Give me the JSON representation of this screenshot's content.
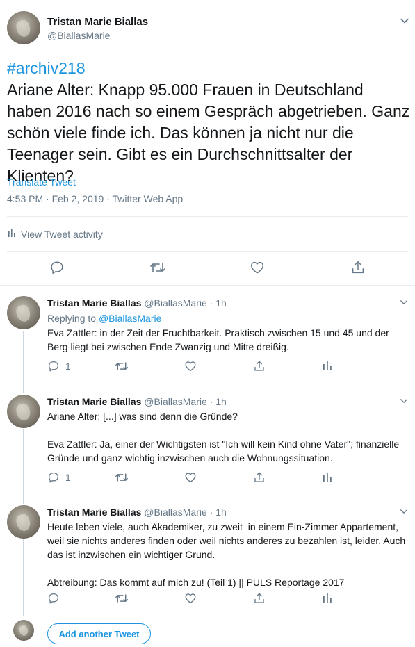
{
  "main_tweet": {
    "author_name": "Tristan Marie Biallas",
    "author_handle": "@BiallasMarie",
    "hashtag": "#archiv218",
    "body": "Ariane Alter: Knapp 95.000 Frauen in Deutschland haben 2016 nach so einem Gespräch abgetrieben. Ganz schön viele finde ich. Das können ja nicht nur die Teenager sein. Gibt es ein Durchschnittsalter der Klienten?",
    "translate_label": "Translate Tweet",
    "meta": "4:53 PM · Feb 2, 2019 · Twitter Web App",
    "activity_label": "View Tweet activity"
  },
  "replies": [
    {
      "author_name": "Tristan Marie Biallas",
      "author_handle": "@BiallasMarie",
      "time": "· 1h",
      "replying_prefix": "Replying to",
      "replying_to": "@BiallasMarie",
      "text": "Eva Zattler: in der Zeit der Fruchtbarkeit. Praktisch zwischen 15 und 45 und der Berg liegt bei zwischen Ende Zwanzig und Mitte dreißig.",
      "reply_count": "1"
    },
    {
      "author_name": "Tristan Marie Biallas",
      "author_handle": "@BiallasMarie",
      "time": "· 1h",
      "text": "Ariane Alter: [...] was sind denn die Gründe?\n\nEva Zattler: Ja, einer der Wichtigsten ist \"Ich will kein Kind ohne Vater\"; finanzielle Gründe und ganz wichtig inzwischen auch die Wohnungssituation.",
      "reply_count": "1"
    },
    {
      "author_name": "Tristan Marie Biallas",
      "author_handle": "@BiallasMarie",
      "time": "· 1h",
      "text": "Heute leben viele, auch Akademiker, zu zweit  in einem Ein-Zimmer Appartement, weil sie nichts anderes finden oder weil nichts anderes zu bezahlen ist, leider. Auch das ist inzwischen ein wichtiger Grund.\n\nAbtreibung: Das kommt auf mich zu! (Teil 1) || PULS Reportage 2017",
      "reply_count": ""
    }
  ],
  "compose": {
    "add_button_label": "Add another Tweet"
  },
  "colors": {
    "accent": "#1b95e0",
    "muted": "#657786",
    "divider": "#e6ecf0"
  },
  "icons": [
    "chevron-down-icon",
    "bar-chart-icon",
    "reply-icon",
    "retweet-icon",
    "like-icon",
    "share-icon",
    "analytics-icon"
  ]
}
